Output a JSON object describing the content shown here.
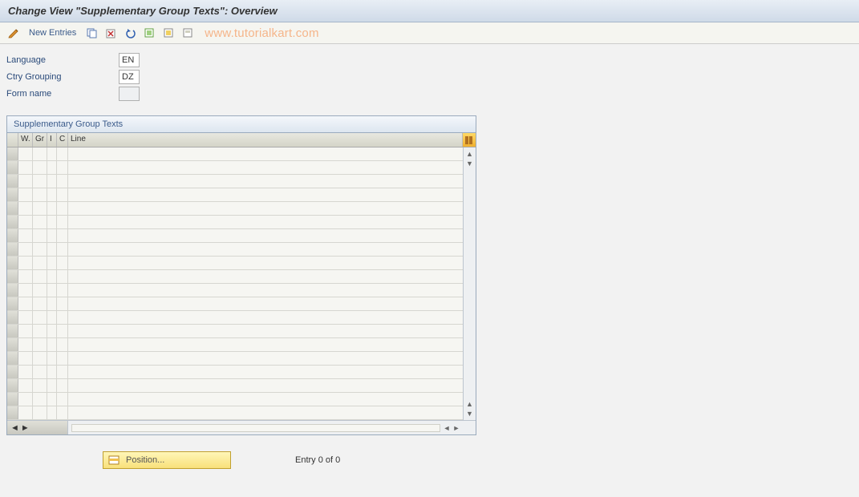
{
  "header": {
    "title": "Change View \"Supplementary Group Texts\": Overview"
  },
  "toolbar": {
    "new_entries_label": "New Entries"
  },
  "watermark": "www.tutorialkart.com",
  "form": {
    "language_label": "Language",
    "language_value": "EN",
    "ctry_grouping_label": "Ctry Grouping",
    "ctry_grouping_value": "DZ",
    "form_name_label": "Form name",
    "form_name_value": ""
  },
  "table": {
    "title": "Supplementary Group Texts",
    "columns": {
      "w": "W.",
      "gr": "Gr",
      "i": "I",
      "c": "C",
      "line": "Line"
    },
    "row_count": 20
  },
  "footer": {
    "position_label": "Position...",
    "entry_text": "Entry 0 of 0"
  }
}
